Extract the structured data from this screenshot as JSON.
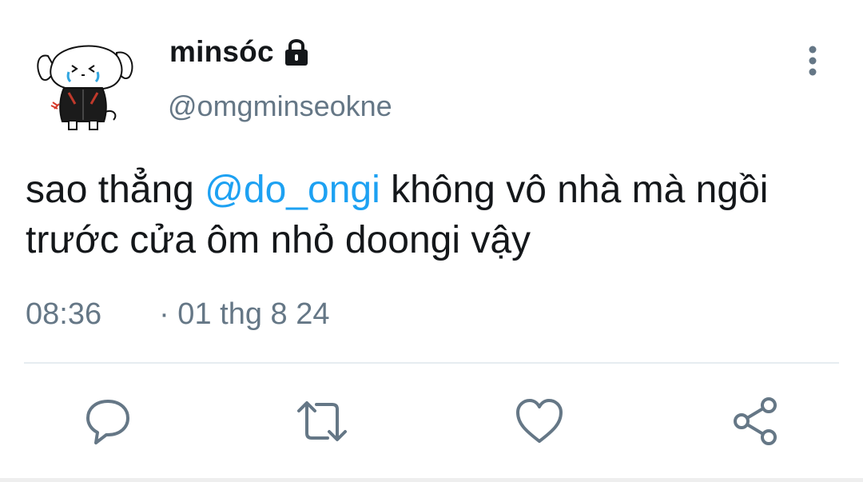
{
  "user": {
    "display_name": "minsóc",
    "handle": "@omgminseokne",
    "avatar_icon": "cartoon-puppy-avatar",
    "protected_icon": "lock-icon"
  },
  "tweet": {
    "text_line1_before": "sao thẳng ",
    "mention": "@do_ongi",
    "text_line1_after": " không vô nhà mà ngồi",
    "text_line2": "trước cửa ôm nhỏ doongi vậy",
    "time": "08:36",
    "date": "· 01 thg 8 24"
  },
  "actions": [
    {
      "name": "reply",
      "icon": "reply-icon"
    },
    {
      "name": "retweet",
      "icon": "retweet-icon"
    },
    {
      "name": "like",
      "icon": "heart-icon"
    },
    {
      "name": "share",
      "icon": "share-icon"
    }
  ],
  "colors": {
    "text": "#14171a",
    "secondary": "#657786",
    "mention": "#1da1f2",
    "divider": "#e6ecf0"
  }
}
